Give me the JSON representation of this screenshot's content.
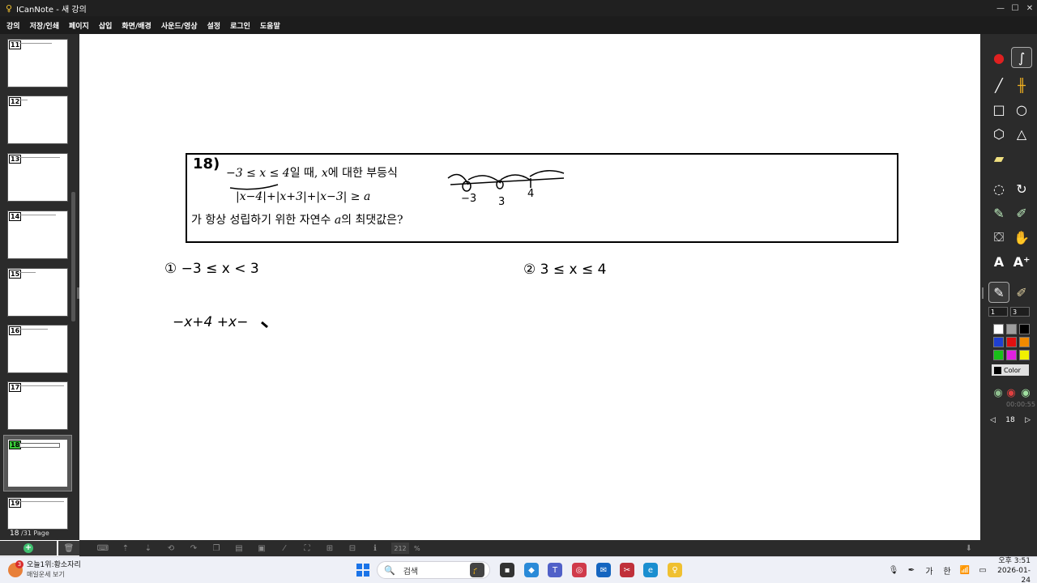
{
  "window": {
    "title": "ICanNote - 새 강의",
    "controls": [
      "—",
      "☐",
      "✕"
    ]
  },
  "menu": [
    "강의",
    "저장/인쇄",
    "페이지",
    "삽입",
    "화면/배경",
    "사운드/영상",
    "설정",
    "로그인",
    "도움말"
  ],
  "thumbnails": [
    {
      "label": "11",
      "active": false
    },
    {
      "label": "12",
      "active": false
    },
    {
      "label": "13",
      "active": false
    },
    {
      "label": "14",
      "active": false
    },
    {
      "label": "15",
      "active": false
    },
    {
      "label": "16",
      "active": false
    },
    {
      "label": "17",
      "active": false
    },
    {
      "label": "18",
      "active": true
    },
    {
      "label": "19",
      "active": false
    }
  ],
  "page_info": {
    "current": "18",
    "total": "/31 Page"
  },
  "problem": {
    "number": "18)",
    "line1_math": "−3 ≤ x ≤ 4",
    "line1_text": "일 때, ",
    "line1_var": "x",
    "line1_rest": "에 대한 부등식",
    "line2": "|x−4|+|x+3|+|x−3| ≥ a",
    "line3_pre": "가 항상 성립하기 위한 자연수 ",
    "line3_var": "a",
    "line3_post": "의 최댓값은?"
  },
  "annotations": {
    "number_line": [
      "−3",
      "3",
      "4"
    ],
    "case1": "① −3 ≤ x < 3",
    "case2": "② 3 ≤ x ≤ 4",
    "work": "−x+4 +x−"
  },
  "bottom": {
    "zoom": "212",
    "zoom_unit": "%"
  },
  "right_panel": {
    "line_width": "1",
    "size": "3",
    "color_label": "Color",
    "rec_time": "00:00:55",
    "page": "18",
    "palette": [
      "#ffffff",
      "#9e9e9e",
      "#000000",
      "#1f3fd0",
      "#e01010",
      "#f08a00",
      "#18c018",
      "#e020e0",
      "#f0f000"
    ]
  },
  "taskbar": {
    "weather_badge": "3",
    "weather_title": "오늘1위:황소자리",
    "weather_sub": "매일운세 보기",
    "search_label": "검색",
    "ime": "가",
    "lang": "한",
    "time": "오후 3:51",
    "date": "2026-01-24"
  }
}
